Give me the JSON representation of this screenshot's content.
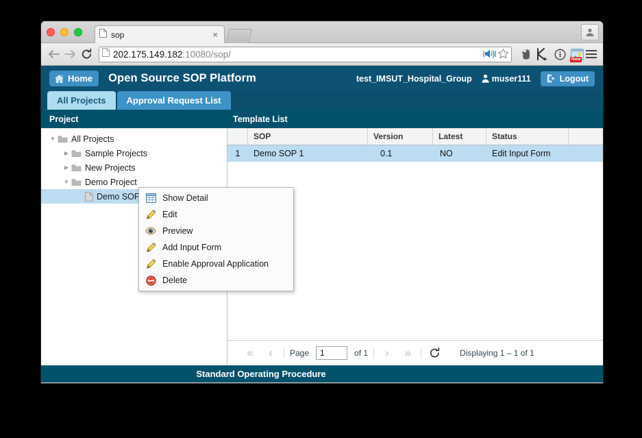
{
  "browser": {
    "tab": {
      "title": "sop",
      "favicon": "page-icon",
      "close": "×"
    },
    "new_tab_tooltip": "New Tab",
    "nav": {
      "back": "←",
      "forward": "→",
      "reload": "⟳"
    },
    "omnibox": {
      "url_host": "202.175.149.182",
      "url_path": ":10080/sop/",
      "page_icon": "page-icon",
      "cast_icon": "cast-speaker-icon",
      "bookmark_icon": "star-icon"
    },
    "extensions": [
      {
        "name": "evernote-icon",
        "badge": ""
      },
      {
        "name": "kami-arrow-icon",
        "badge": ""
      },
      {
        "name": "info-circle-icon",
        "badge": ""
      },
      {
        "name": "screenshot-icon",
        "badge": "New"
      }
    ],
    "menu_icon": "hamburger-menu-icon",
    "profile_icon": "profile-avatar-icon"
  },
  "app": {
    "header": {
      "home_label": "Home",
      "home_icon": "house-icon",
      "title": "Open Source SOP Platform",
      "group_name": "test_IMSUT_Hospital_Group",
      "user_icon": "user-icon",
      "user_name": "muser111",
      "logout_label": "Logout",
      "logout_icon": "logout-arrow-icon"
    },
    "tabs": [
      {
        "label": "All Projects",
        "active": true
      },
      {
        "label": "Approval Request List",
        "active": false
      }
    ],
    "section_bar": {
      "project_label": "Project",
      "template_label": "Template List"
    },
    "sidebar": {
      "items": [
        {
          "label": "All Projects",
          "indent": 0,
          "arrow": "▼",
          "icon": "folder-icon",
          "selected": false
        },
        {
          "label": "Sample Projects",
          "indent": 1,
          "arrow": "▶",
          "icon": "folder-icon",
          "selected": false
        },
        {
          "label": "New Projects",
          "indent": 1,
          "arrow": "▶",
          "icon": "folder-icon",
          "selected": false
        },
        {
          "label": "Demo Project",
          "indent": 1,
          "arrow": "▼",
          "icon": "folder-icon",
          "selected": false
        },
        {
          "label": "Demo SOP 1",
          "indent": 2,
          "arrow": "",
          "icon": "document-icon",
          "selected": true
        }
      ]
    },
    "grid": {
      "columns": [
        "",
        "SOP",
        "Version",
        "Latest",
        "Status",
        ""
      ],
      "rows": [
        {
          "num": "1",
          "sop": "Demo SOP 1",
          "version": "0.1",
          "latest": "NO",
          "status": "Edit Input Form",
          "selected": true
        }
      ]
    },
    "paging": {
      "first_icon": "«",
      "prev_icon": "‹",
      "page_label": "Page",
      "page_value": "1",
      "of_label": "of 1",
      "next_icon": "›",
      "last_icon": "»",
      "refresh_icon": "⟳",
      "display_text": "Displaying 1 – 1 of 1"
    },
    "footer": {
      "text": "Standard Operating Procedure"
    },
    "context_menu": {
      "items": [
        {
          "label": "Show Detail",
          "icon": "grid-detail-icon"
        },
        {
          "label": "Edit",
          "icon": "pencil-icon"
        },
        {
          "label": "Preview",
          "icon": "eye-icon"
        },
        {
          "label": "Add Input Form",
          "icon": "pencil-icon"
        },
        {
          "label": "Enable Approval Application",
          "icon": "pencil-icon"
        },
        {
          "label": "Delete",
          "icon": "delete-circle-icon"
        }
      ]
    },
    "colors": {
      "header_bg": "#0d5273",
      "band_bg": "#03526b",
      "accent_blue": "#3d8fc4",
      "tab_active_bg": "#aedcf0",
      "tab_inactive_bg": "#3d93c7",
      "row_selected": "#bcdcf2",
      "grid_header_bg": "#f4f4f4"
    }
  }
}
